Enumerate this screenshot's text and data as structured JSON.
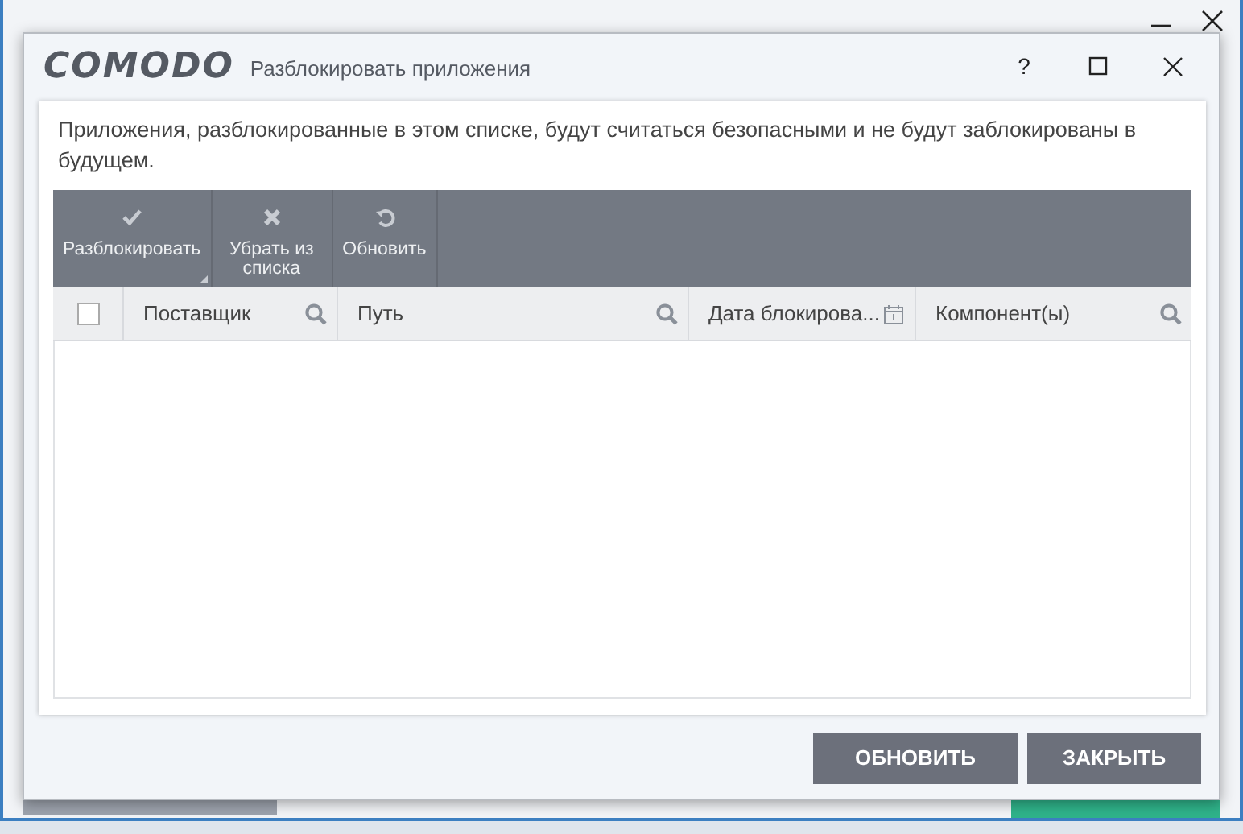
{
  "window": {
    "logo": "COMODO",
    "title": "Разблокировать приложения",
    "controls": [
      "?"
    ]
  },
  "description": "Приложения, разблокированные в этом списке, будут считаться безопасными и не будут заблокированы в будущем.",
  "toolbar": [
    {
      "kind": "check",
      "label": "Разблокировать",
      "dropdown": true
    },
    {
      "kind": "remove",
      "label": "Убрать из списка",
      "dropdown": false
    },
    {
      "kind": "refresh",
      "label": "Обновить",
      "dropdown": false
    }
  ],
  "table": {
    "select_all": {
      "checked": false
    },
    "columns": [
      {
        "label": "Поставщик",
        "kind": "search"
      },
      {
        "label": "Путь",
        "kind": "search"
      },
      {
        "label": "Дата блокирова...",
        "kind": "calendar"
      },
      {
        "label": "Компонент(ы)",
        "kind": "search"
      }
    ]
  },
  "buttons": [
    "ОБНОВИТЬ",
    "ЗАКРЫТЬ"
  ]
}
